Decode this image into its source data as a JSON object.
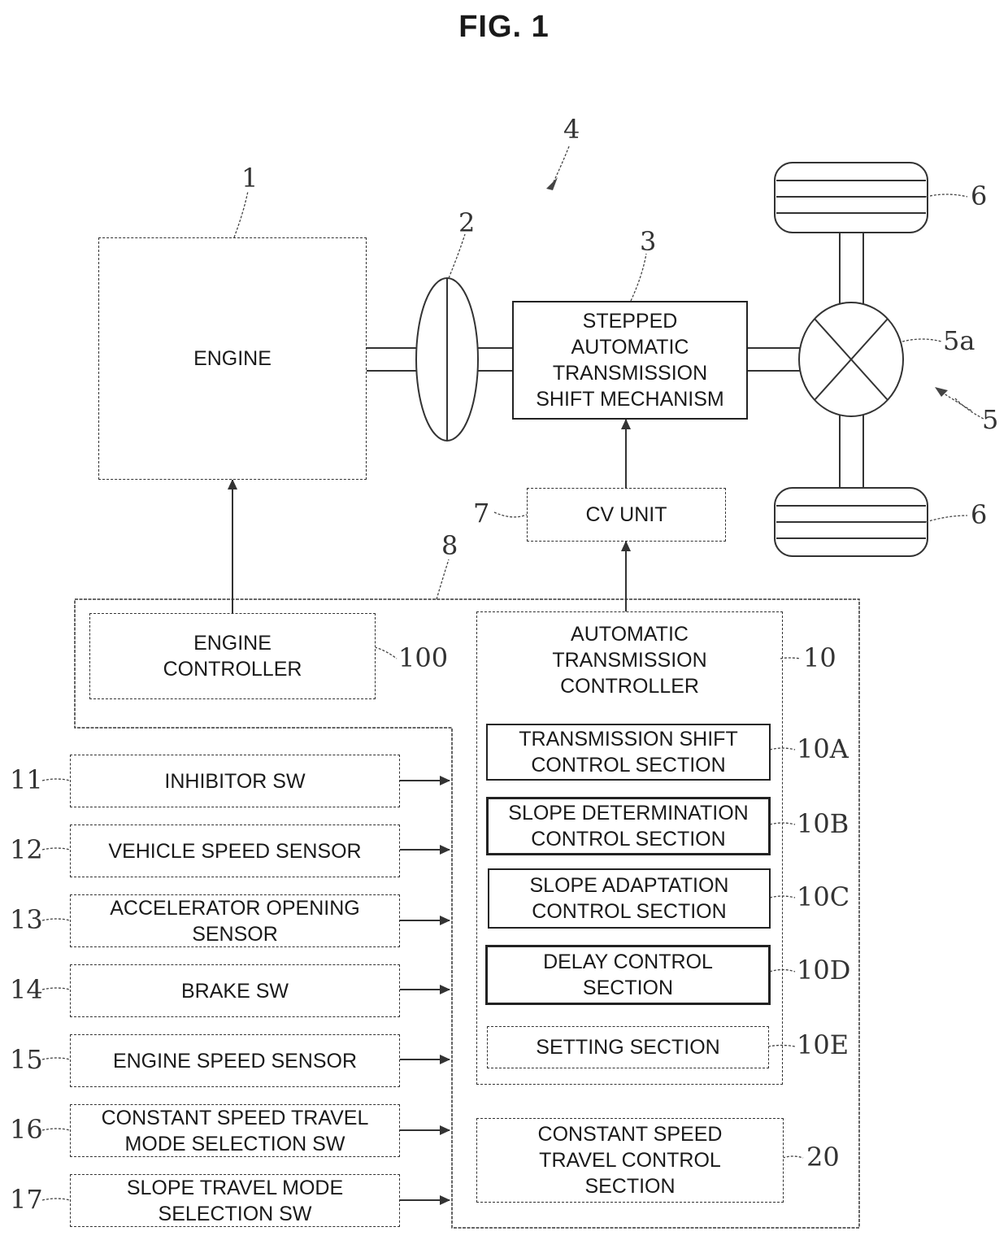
{
  "figure": {
    "title": "FIG. 1"
  },
  "drivetrain": {
    "engine": {
      "label": "ENGINE",
      "ref": "1"
    },
    "torque_converter": {
      "ref": "2"
    },
    "transmission": {
      "label": "STEPPED\nAUTOMATIC\nTRANSMISSION\nSHIFT MECHANISM",
      "ref": "3"
    },
    "powertrain_ref": "4",
    "final_drive": {
      "ref": "5"
    },
    "differential": {
      "ref": "5a"
    },
    "wheels": [
      {
        "ref": "6"
      },
      {
        "ref": "6"
      }
    ],
    "cv_unit": {
      "label": "CV UNIT",
      "ref": "7"
    }
  },
  "controller_unit": {
    "ref": "8",
    "engine_controller": {
      "label": "ENGINE\nCONTROLLER",
      "ref": "100"
    },
    "at_controller": {
      "label": "AUTOMATIC\nTRANSMISSION\nCONTROLLER",
      "ref": "10",
      "sections": [
        {
          "label": "TRANSMISSION SHIFT\nCONTROL SECTION",
          "ref": "10A"
        },
        {
          "label": "SLOPE DETERMINATION\nCONTROL SECTION",
          "ref": "10B"
        },
        {
          "label": "SLOPE ADAPTATION\nCONTROL SECTION",
          "ref": "10C"
        },
        {
          "label": "DELAY CONTROL\nSECTION",
          "ref": "10D"
        },
        {
          "label": "SETTING SECTION",
          "ref": "10E"
        }
      ]
    },
    "constant_speed_control": {
      "label": "CONSTANT SPEED\nTRAVEL CONTROL\nSECTION",
      "ref": "20"
    }
  },
  "inputs": [
    {
      "label": "INHIBITOR SW",
      "ref": "11"
    },
    {
      "label": "VEHICLE SPEED SENSOR",
      "ref": "12"
    },
    {
      "label": "ACCELERATOR OPENING\nSENSOR",
      "ref": "13"
    },
    {
      "label": "BRAKE SW",
      "ref": "14"
    },
    {
      "label": "ENGINE SPEED SENSOR",
      "ref": "15"
    },
    {
      "label": "CONSTANT SPEED TRAVEL\nMODE SELECTION SW",
      "ref": "16"
    },
    {
      "label": "SLOPE TRAVEL MODE\nSELECTION SW",
      "ref": "17"
    }
  ]
}
